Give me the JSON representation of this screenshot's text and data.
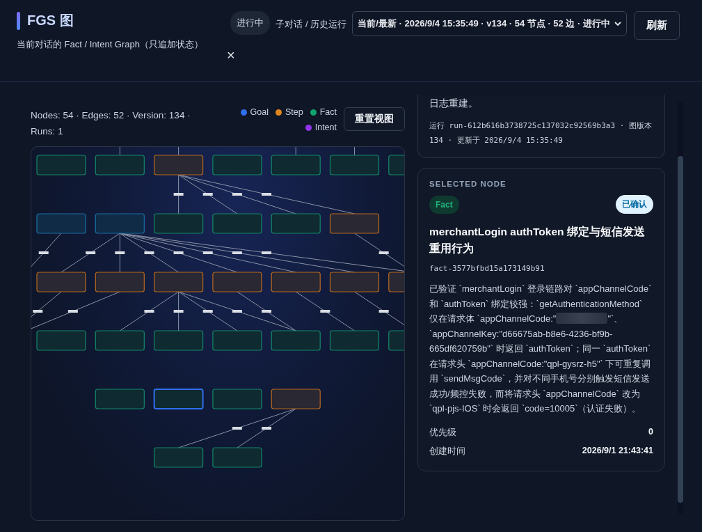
{
  "header": {
    "title": "FGS 图",
    "subtitle": "当前对话的 Fact / Intent Graph（只追加状态）",
    "status": "进行中",
    "run_label": "子对话 / 历史运行",
    "run_select": "当前/最新 · 2026/9/4 15:35:49 · v134 · 54 节点 · 52 边 · 进行中",
    "refresh": "刷新",
    "close": "×"
  },
  "graph": {
    "stats": "Nodes: 54 · Edges: 52 · Version: 134 · Runs: 1",
    "reset": "重置视图",
    "legend": [
      {
        "label": "Goal",
        "color": "#2f6fed"
      },
      {
        "label": "Step",
        "color": "#e0861c"
      },
      {
        "label": "Fact",
        "color": "#10a36e"
      },
      {
        "label": "Intent",
        "color": "#9333ea"
      }
    ],
    "rows": [
      [
        {
          "kind": "fact",
          "selected": false
        },
        {
          "kind": "fact",
          "selected": false
        },
        {
          "kind": "step",
          "selected": false
        },
        {
          "kind": "fact",
          "selected": false
        },
        {
          "kind": "fact",
          "selected": false
        },
        {
          "kind": "fact",
          "selected": false
        },
        {
          "kind": "fact",
          "selected": false
        }
      ],
      [
        {
          "kind": "goal",
          "selected": false
        },
        {
          "kind": "goal",
          "selected": false
        },
        {
          "kind": "fact",
          "selected": false
        },
        {
          "kind": "fact",
          "selected": false
        },
        {
          "kind": "fact",
          "selected": false
        },
        {
          "kind": "step",
          "selected": false
        }
      ],
      [
        {
          "kind": "step",
          "selected": false
        },
        {
          "kind": "step",
          "selected": false
        },
        {
          "kind": "step",
          "selected": false
        },
        {
          "kind": "step",
          "selected": false
        },
        {
          "kind": "step",
          "selected": false
        },
        {
          "kind": "step",
          "selected": false
        },
        {
          "kind": "step",
          "selected": false
        }
      ],
      [
        {
          "kind": "fact",
          "selected": false
        },
        {
          "kind": "fact",
          "selected": false
        },
        {
          "kind": "fact",
          "selected": false
        },
        {
          "kind": "fact",
          "selected": false
        },
        {
          "kind": "fact",
          "selected": false
        },
        {
          "kind": "fact",
          "selected": false
        },
        {
          "kind": "fact",
          "selected": false
        }
      ],
      [
        null,
        {
          "kind": "fact",
          "selected": false
        },
        {
          "kind": "fact",
          "selected": true
        },
        {
          "kind": "fact",
          "selected": false
        },
        {
          "kind": "step",
          "selected": false
        }
      ],
      [
        null,
        null,
        {
          "kind": "fact",
          "selected": false
        },
        {
          "kind": "fact",
          "selected": false
        }
      ]
    ]
  },
  "info_card": {
    "text": "日志重建。",
    "meta": "运行 run-612b616b3738725c137032c92569b3a3 · 图版本 134 · 更新于 2026/9/4 15:35:49"
  },
  "selected_node": {
    "heading": "SELECTED NODE",
    "kind": "Fact",
    "status": "已确认",
    "title": "merchantLogin authToken 绑定与短信发送重用行为",
    "id": "fact-3577bfbd15a173149b91",
    "description_before": "已验证 `merchantLogin` 登录链路对 `appChannelCode` 和 `authToken` 绑定较强：`getAuthenticationMethod` 仅在请求体 `appChannelCode:\"",
    "description_after": "\"`、`appChannelKey:\"d66675ab-b8e6-4236-bf9b-665df620759b\"` 时返回 `authToken`；同一 `authToken` 在请求头 `appChannelCode:\"qpl-gysrz-h5\"` 下可重复调用 `sendMsgCode`，并对不同手机号分别触发短信发送成功/频控失败，而将请求头 `appChannelCode` 改为 `qpl-pjs-IOS` 时会返回 `code=10005`（认证失败）。",
    "fields": [
      {
        "label": "优先级",
        "value": "0"
      },
      {
        "label": "创建时间",
        "value": "2026/9/1 21:43:41"
      }
    ]
  }
}
